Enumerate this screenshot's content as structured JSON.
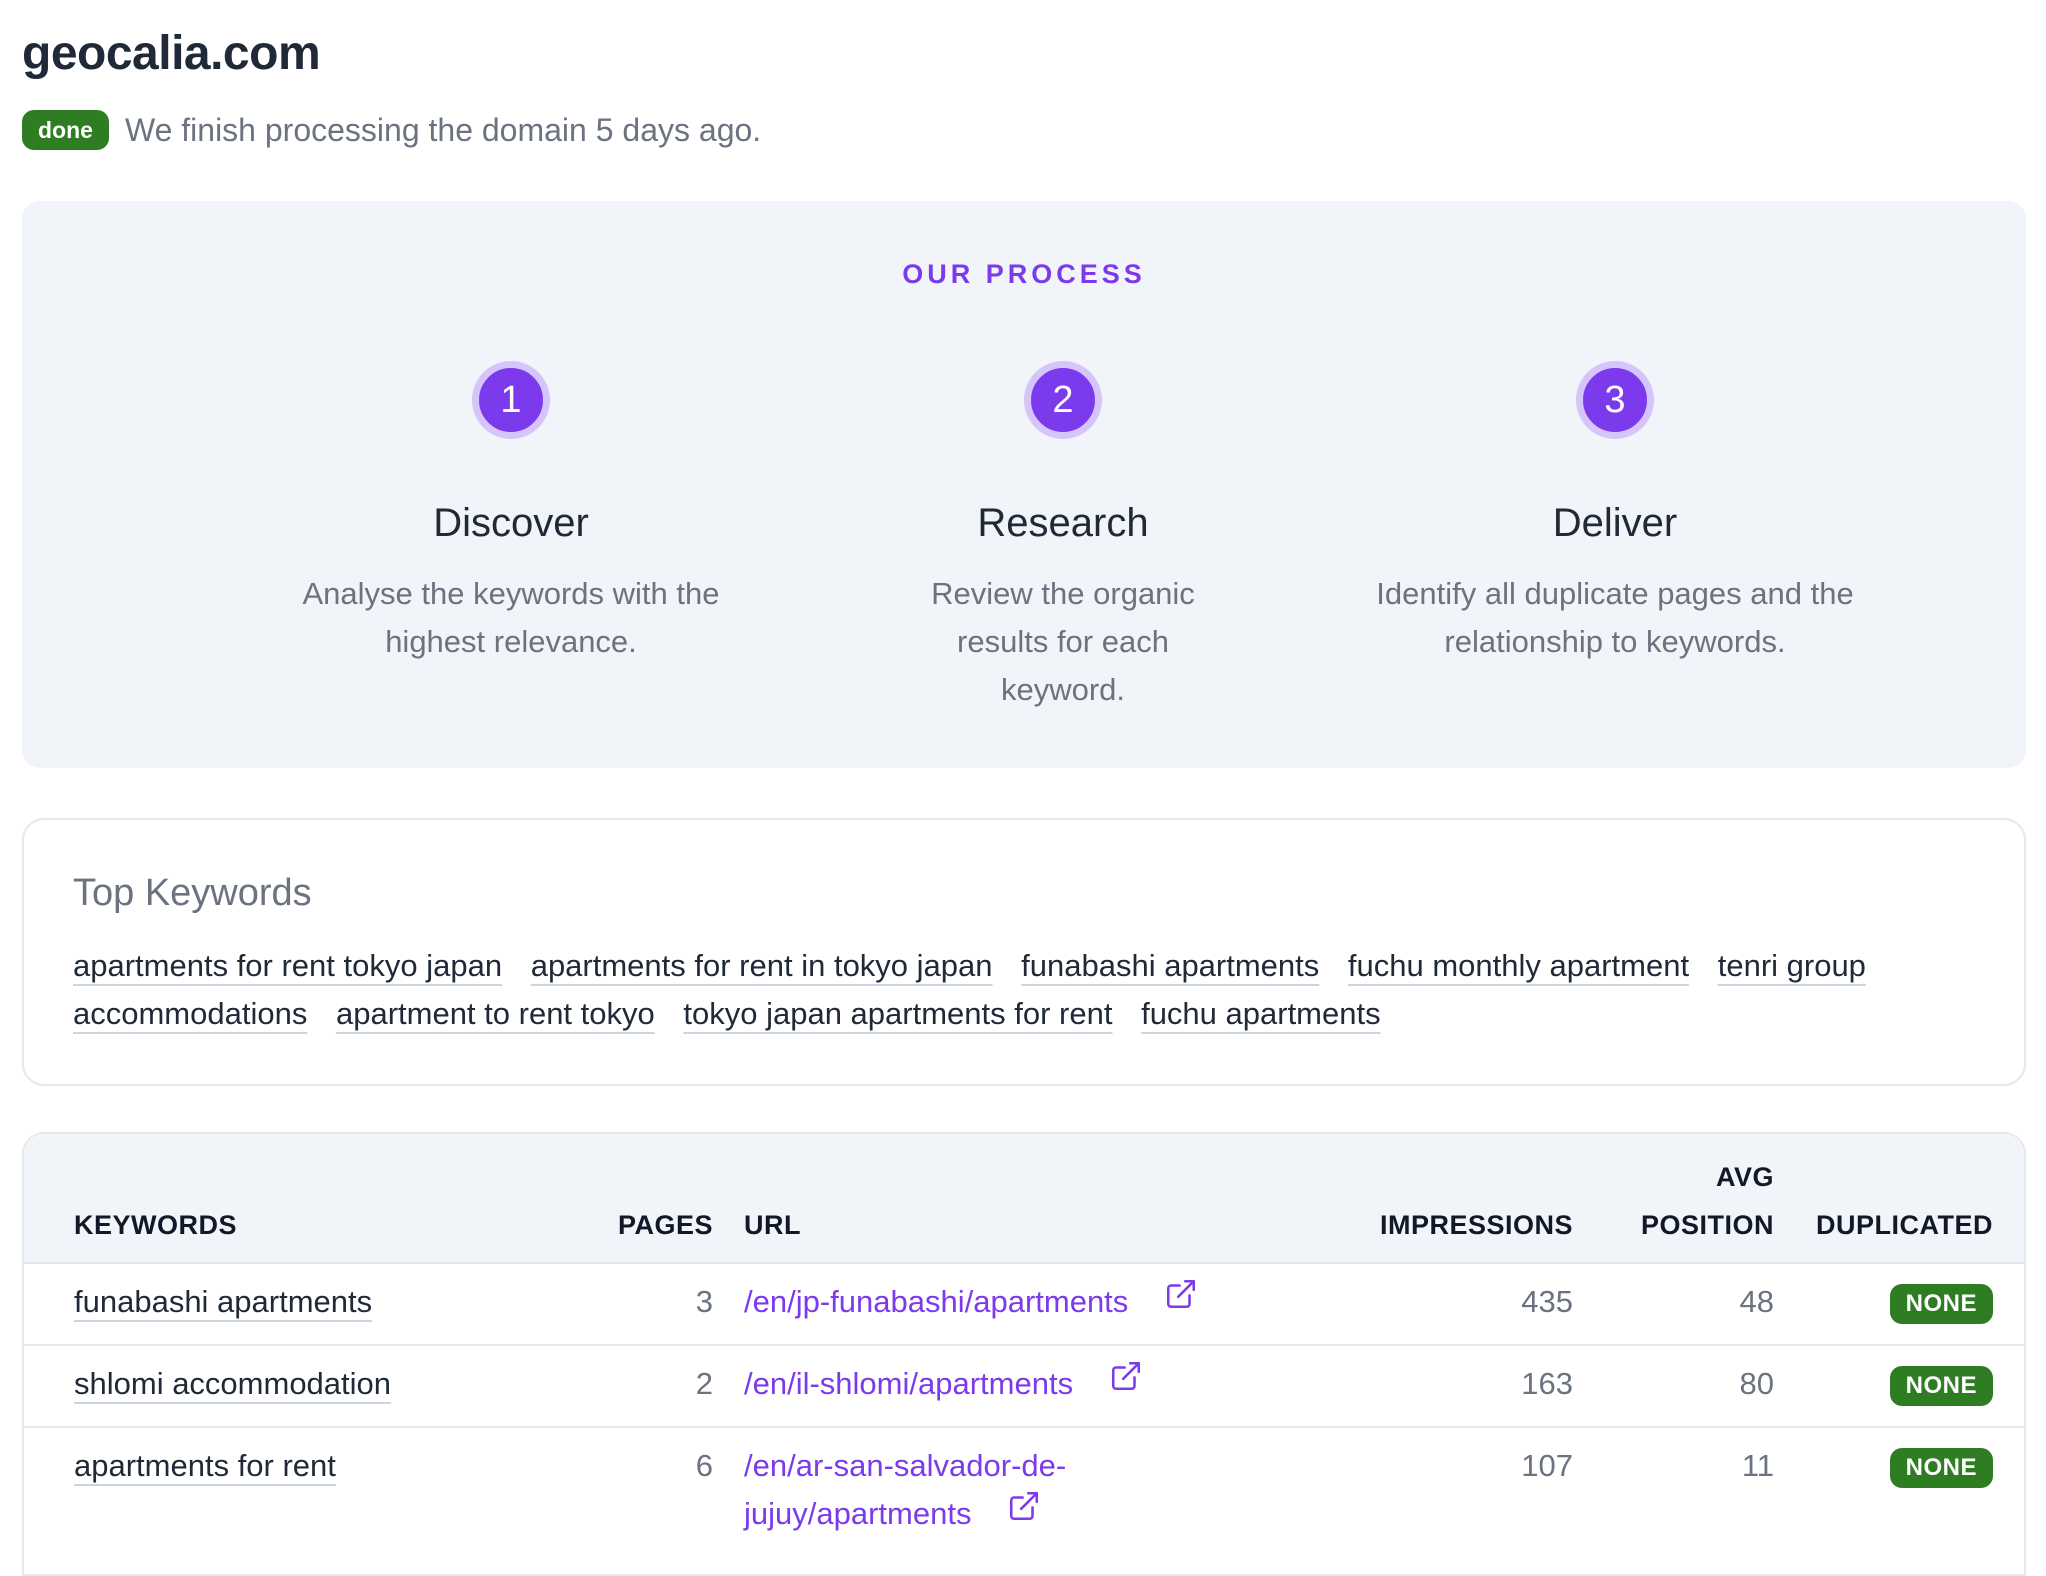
{
  "header": {
    "domain": "geocalia.com",
    "status_badge": "done",
    "status_text": "We finish processing the domain 5 days ago."
  },
  "process": {
    "heading": "OUR PROCESS",
    "steps": [
      {
        "number": "1",
        "title": "Discover",
        "description": "Analyse the keywords with the highest relevance."
      },
      {
        "number": "2",
        "title": "Research",
        "description": "Review the organic results for each keyword."
      },
      {
        "number": "3",
        "title": "Deliver",
        "description": "Identify all duplicate pages and the relationship to keywords."
      }
    ]
  },
  "top_keywords": {
    "title": "Top Keywords",
    "items": [
      "apartments for rent tokyo japan",
      "apartments for rent in tokyo japan",
      "funabashi apartments",
      "fuchu monthly apartment",
      "tenri group accommodations",
      "apartment to rent tokyo",
      "tokyo japan apartments for rent",
      "fuchu apartments"
    ]
  },
  "table": {
    "columns": {
      "keywords": "KEYWORDS",
      "pages": "PAGES",
      "url": "URL",
      "impressions": "IMPRESSIONS",
      "avg_position_line1": "AVG",
      "avg_position_line2": "POSITION",
      "duplicated": "DUPLICATED"
    },
    "rows": [
      {
        "keyword": "funabashi apartments",
        "pages": "3",
        "url": "/en/jp-funabashi/apartments",
        "impressions": "435",
        "avg_position": "48",
        "duplicated": "NONE"
      },
      {
        "keyword": "shlomi accommodation",
        "pages": "2",
        "url": "/en/il-shlomi/apartments",
        "impressions": "163",
        "avg_position": "80",
        "duplicated": "NONE"
      },
      {
        "keyword": "apartments for rent",
        "pages": "6",
        "url": "/en/ar-san-salvador-de-jujuy/apartments",
        "impressions": "107",
        "avg_position": "11",
        "duplicated": "NONE"
      }
    ]
  },
  "colors": {
    "accent": "#7c3aed",
    "success": "#2f7d22",
    "panel": "#f1f4f9",
    "muted_text": "#6b7280"
  },
  "icons": {
    "external_link": "external-link-icon"
  }
}
